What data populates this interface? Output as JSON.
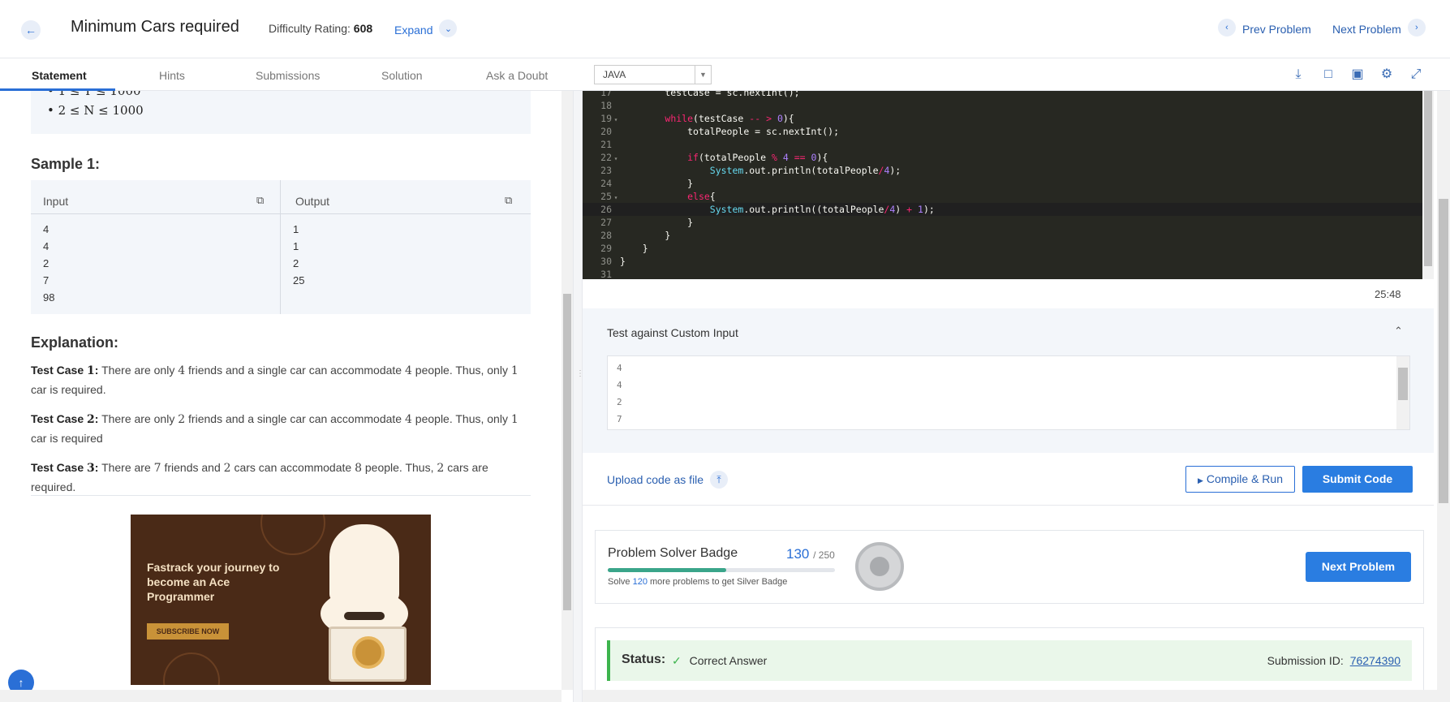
{
  "header": {
    "title": "Minimum Cars required",
    "difficulty_label": "Difficulty Rating:",
    "difficulty_value": "608",
    "expand_label": "Expand",
    "prev_label": "Prev Problem",
    "next_label": "Next Problem"
  },
  "tabs": [
    "Statement",
    "Hints",
    "Submissions",
    "Solution",
    "Ask a Doubt"
  ],
  "editor_toolbar": {
    "language": "JAVA"
  },
  "statement": {
    "sample_title": "Sample 1:",
    "input_header": "Input",
    "output_header": "Output",
    "inputs": [
      "4",
      "4",
      "2",
      "7",
      "98"
    ],
    "outputs": [
      "1",
      "1",
      "2",
      "25"
    ],
    "explanation_title": "Explanation:",
    "test_cases": [
      {
        "label": "Test Case",
        "num": "1",
        "text_a": "There are only",
        "friends": "4",
        "text_b": "friends and a single car can accommodate",
        "cap": "4",
        "text_c": "people. Thus, only",
        "cars": "1",
        "text_d": "car is required."
      },
      {
        "label": "Test Case",
        "num": "2",
        "text_a": "There are only",
        "friends": "2",
        "text_b": "friends and a single car can accommodate",
        "cap": "4",
        "text_c": "people. Thus, only",
        "cars": "1",
        "text_d": "car is required"
      },
      {
        "label": "Test Case",
        "num": "3",
        "text_a": "There are",
        "friends": "7",
        "text_b": "friends and",
        "cap": "2",
        "text_c": "cars can accommodate",
        "cars": "8",
        "text_d": "people. Thus,",
        "extra_num": "2",
        "text_e": "cars are required."
      }
    ]
  },
  "ad": {
    "text": "Fastrack your journey to become an Ace Programmer",
    "button": "SUBSCRIBE NOW"
  },
  "timer": "25:48",
  "custom_input": {
    "title": "Test against Custom Input",
    "lines": [
      "4",
      "4",
      "2",
      "7"
    ]
  },
  "actions": {
    "upload_label": "Upload code as file",
    "compile_label": "Compile & Run",
    "submit_label": "Submit Code"
  },
  "badge": {
    "title": "Problem Solver Badge",
    "solved": "130",
    "total": "/ 250",
    "progress": 0.52,
    "sub_a": "Solve",
    "sub_count": "120",
    "sub_b": "more problems to get Silver Badge",
    "next_button": "Next Problem"
  },
  "status": {
    "label": "Status:",
    "value": "Correct Answer",
    "submission_label": "Submission ID:",
    "submission_id": "76274390"
  },
  "colors": {
    "accent": "#2a6fd6",
    "editor_bg": "#272822",
    "success": "#3db44d",
    "badge_progress": "#3aa58a"
  }
}
